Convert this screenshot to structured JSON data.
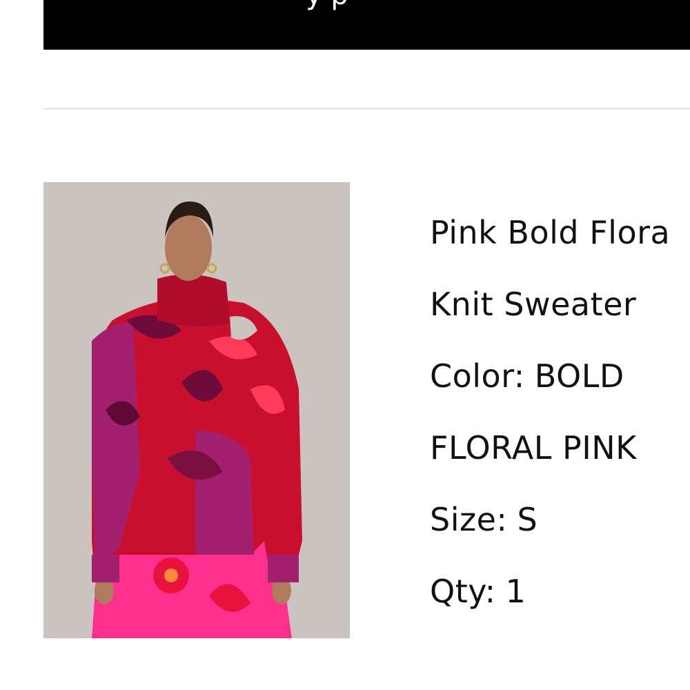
{
  "banner": {
    "text": "y p"
  },
  "product": {
    "image_alt": "Pink Bold Floral Knit Sweater",
    "name_line1": "Pink Bold Flora",
    "name_line2": "Knit Sweater",
    "color_label": "Color:",
    "color_value_line1": "BOLD",
    "color_value_line2": "FLORAL PINK",
    "size_label": "Size:",
    "size_value": "S",
    "qty_label": "Qty:",
    "qty_value": "1"
  },
  "colors": {
    "banner_bg": "#000000",
    "divider": "#e6e6ee",
    "image_bg": "#cbc3bf",
    "sweater_red": "#c8102e",
    "sweater_magenta": "#a3206f",
    "skirt_pink": "#ff2f8e"
  }
}
